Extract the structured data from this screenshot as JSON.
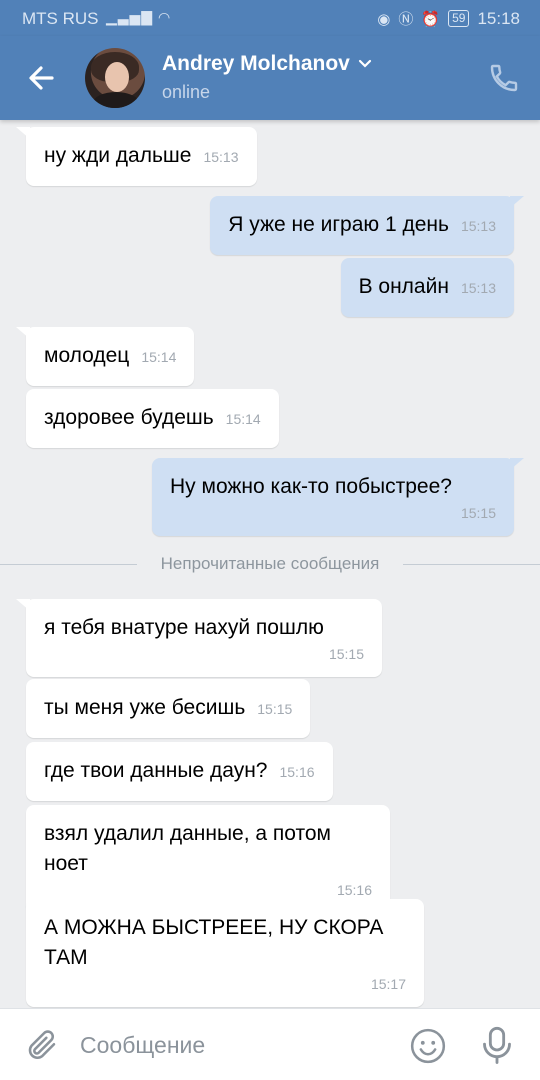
{
  "status_bar": {
    "carrier": "MTS RUS",
    "battery": "59",
    "time": "15:18"
  },
  "header": {
    "name": "Andrey Molchanov",
    "presence": "online"
  },
  "messages": [
    {
      "dir": "in",
      "text": "ну жди дальше",
      "time": "15:13"
    },
    {
      "dir": "out",
      "text": "Я уже не играю 1 день",
      "time": "15:13"
    },
    {
      "dir": "out",
      "text": "В онлайн",
      "time": "15:13"
    },
    {
      "dir": "in",
      "text": "молодец",
      "time": "15:14"
    },
    {
      "dir": "in",
      "text": "здоровее будешь",
      "time": "15:14"
    },
    {
      "dir": "out",
      "text": "Ну можно как-то побыстрее?",
      "time": "15:15"
    },
    {
      "dir": "in",
      "text": "я тебя внатуре нахуй пошлю",
      "time": "15:15"
    },
    {
      "dir": "in",
      "text": "ты меня уже бесишь",
      "time": "15:15"
    },
    {
      "dir": "in",
      "text": "где твои данные даун?",
      "time": "15:16"
    },
    {
      "dir": "in",
      "text": "взял удалил данные, а потом ноет",
      "time": "15:16"
    },
    {
      "dir": "in",
      "text": "А МОЖНА БЫСТРЕЕЕ, НУ СКОРА ТАМ",
      "time": "15:17"
    }
  ],
  "unread_divider": "Непрочитанные сообщения",
  "composer": {
    "placeholder": "Сообщение"
  },
  "colors": {
    "header": "#5181b8",
    "background": "#edeef0",
    "outgoing_bubble": "#cfdff3",
    "incoming_bubble": "#ffffff"
  }
}
